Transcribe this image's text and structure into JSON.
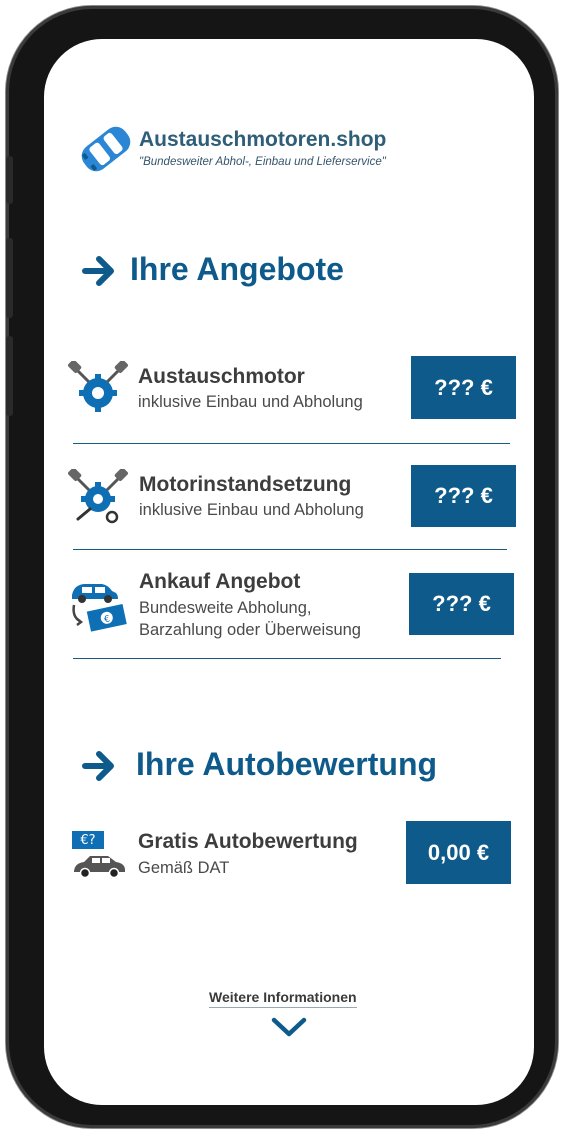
{
  "logo": {
    "title": "Austauschmotoren.shop",
    "tagline": "\"Bundesweiter Abhol-, Einbau und Lieferservice\""
  },
  "sections": {
    "offers_title": "Ihre Angebote",
    "valuation_title": "Ihre Autobewertung"
  },
  "offers": [
    {
      "title": "Austauschmotor",
      "subtitle": "inklusive Einbau und Abholung",
      "price": "??? €",
      "icon": "engine-gear-icon"
    },
    {
      "title": "Motorinstandsetzung",
      "subtitle": "inklusive Einbau und Abholung",
      "price": "??? €",
      "icon": "engine-repair-icon"
    },
    {
      "title": "Ankauf Angebot",
      "subtitle_line1": "Bundesweite Abholung,",
      "subtitle_line2": "Barzahlung oder Überweisung",
      "price": "??? €",
      "icon": "car-money-icon"
    }
  ],
  "valuation": {
    "title": "Gratis Autobewertung",
    "subtitle": "Gemäß DAT",
    "price": "0,00 €",
    "badge": "€?",
    "icon": "car-valuation-icon"
  },
  "footer": {
    "more_label": "Weitere Informationen",
    "icon": "chevron-down-icon"
  },
  "colors": {
    "brand_blue": "#0e5a8a",
    "text_dark": "#3d3d3d",
    "frame": "#151515"
  }
}
